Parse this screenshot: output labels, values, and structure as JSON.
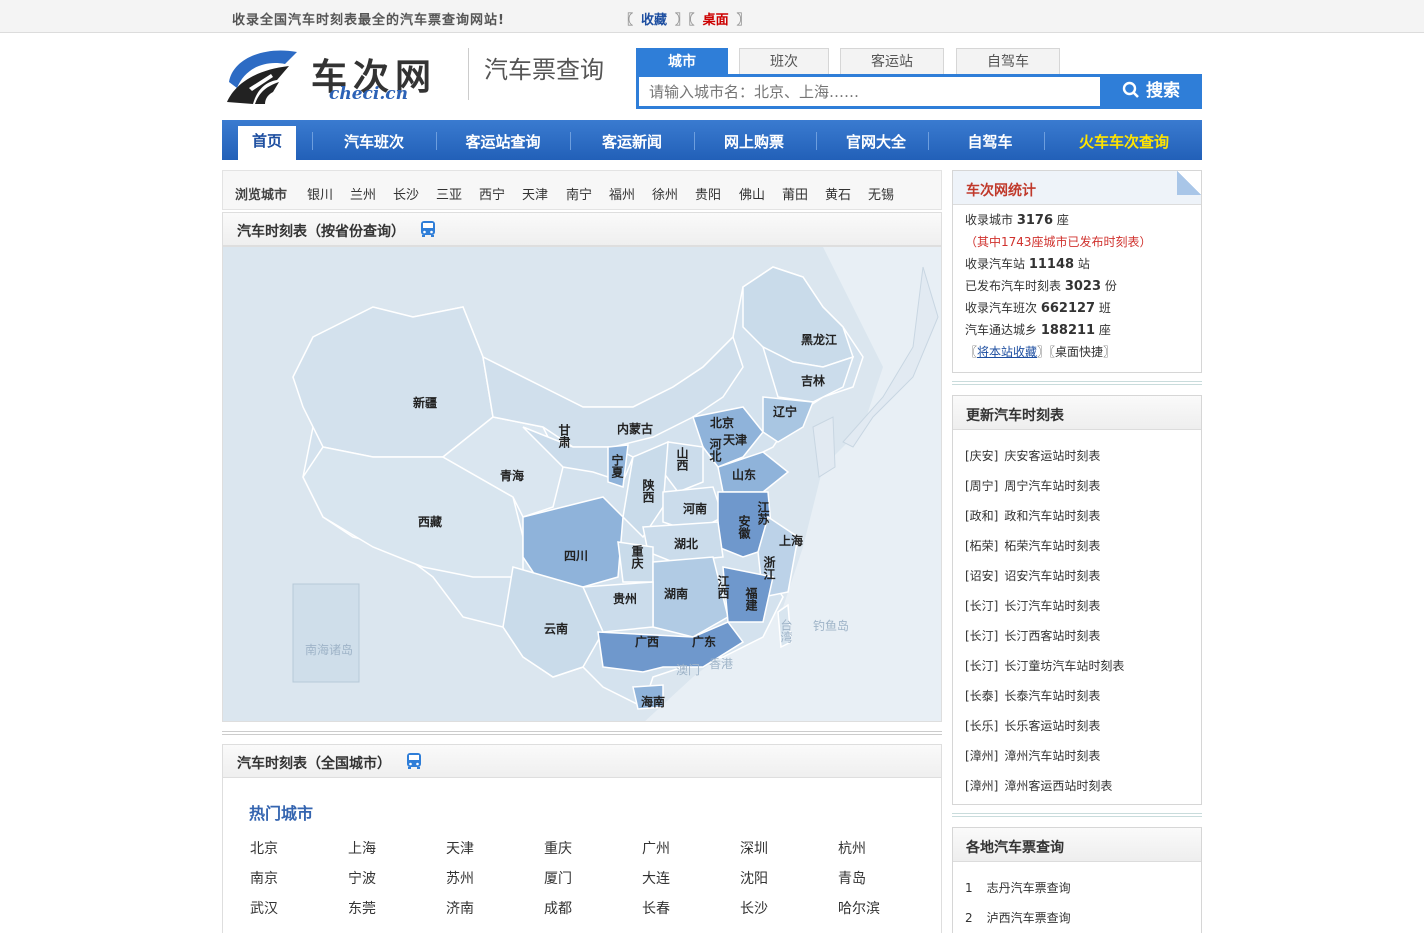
{
  "topbar": {
    "slogan": "收录全国汽车时刻表最全的汽车票查询网站!",
    "bracket_l": "〖",
    "bracket_r": "〗",
    "fav": "收藏",
    "desktop": "桌面"
  },
  "logo": {
    "cn": "车次网",
    "en": "checi.cn"
  },
  "header_title": "汽车票查询",
  "search": {
    "tabs": [
      "城市",
      "班次",
      "客运站",
      "自驾车"
    ],
    "placeholder": "请输入城市名：北京、上海……",
    "button": "搜索"
  },
  "nav": [
    "首页",
    "汽车班次",
    "客运站查询",
    "客运新闻",
    "网上购票",
    "官网大全",
    "自驾车",
    "火车车次查询"
  ],
  "browse": {
    "label": "浏览城市",
    "cities": [
      "银川",
      "兰州",
      "长沙",
      "三亚",
      "西宁",
      "天津",
      "南宁",
      "福州",
      "徐州",
      "贵阳",
      "佛山",
      "莆田",
      "黄石",
      "无锡"
    ]
  },
  "map_panel": {
    "title": "汽车时刻表（按省份查询）",
    "provinces": [
      "黑龙江",
      "吉林",
      "辽宁",
      "北京",
      "天津",
      "河北",
      "山东",
      "内蒙古",
      "新疆",
      "甘肃",
      "宁夏",
      "山西",
      "陕西",
      "青海",
      "西藏",
      "河南",
      "江苏",
      "安徽",
      "上海",
      "四川",
      "湖北",
      "重庆",
      "浙江",
      "江西",
      "湖南",
      "贵州",
      "福建",
      "云南",
      "广西",
      "广东",
      "台湾",
      "钓鱼岛",
      "澳门",
      "香港",
      "海南",
      "南海诸岛"
    ]
  },
  "hot_panel": {
    "title": "汽车时刻表（全国城市）",
    "subtitle": "热门城市",
    "cities": [
      "北京",
      "上海",
      "天津",
      "重庆",
      "广州",
      "深圳",
      "杭州",
      "南京",
      "宁波",
      "苏州",
      "厦门",
      "大连",
      "沈阳",
      "青岛",
      "武汉",
      "东莞",
      "济南",
      "成都",
      "长春",
      "长沙",
      "哈尔滨"
    ]
  },
  "stats": {
    "title": "车次网统计",
    "rows": [
      {
        "pre": "收录城市 ",
        "num": "3176",
        "post": " 座"
      },
      {
        "pre": "（其中1743座城市已发布时刻表）",
        "num": "",
        "post": ""
      },
      {
        "pre": "收录汽车站 ",
        "num": "11148",
        "post": " 站"
      },
      {
        "pre": "已发布汽车时刻表 ",
        "num": "3023",
        "post": " 份"
      },
      {
        "pre": "收录汽车班次 ",
        "num": "662127",
        "post": " 班"
      },
      {
        "pre": "汽车通达城乡 ",
        "num": "188211",
        "post": " 座"
      }
    ],
    "links": [
      "将本站收藏",
      "桌面快捷"
    ]
  },
  "updates": {
    "title": "更新汽车时刻表",
    "items": [
      {
        "tag": "[庆安]",
        "name": "庆安客运站时刻表"
      },
      {
        "tag": "[周宁]",
        "name": "周宁汽车站时刻表"
      },
      {
        "tag": "[政和]",
        "name": "政和汽车站时刻表"
      },
      {
        "tag": "[柘荣]",
        "name": "柘荣汽车站时刻表"
      },
      {
        "tag": "[诏安]",
        "name": "诏安汽车站时刻表"
      },
      {
        "tag": "[长汀]",
        "name": "长汀汽车站时刻表"
      },
      {
        "tag": "[长汀]",
        "name": "长汀西客站时刻表"
      },
      {
        "tag": "[长汀]",
        "name": "长汀童坊汽车站时刻表"
      },
      {
        "tag": "[长泰]",
        "name": "长泰汽车站时刻表"
      },
      {
        "tag": "[长乐]",
        "name": "长乐客运站时刻表"
      },
      {
        "tag": "[漳州]",
        "name": "漳州汽车站时刻表"
      },
      {
        "tag": "[漳州]",
        "name": "漳州客运西站时刻表"
      }
    ]
  },
  "regional": {
    "title": "各地汽车票查询",
    "items": [
      {
        "num": "1",
        "name": "志丹汽车票查询"
      },
      {
        "num": "2",
        "name": "泸西汽车票查询"
      }
    ]
  },
  "colors": {
    "brand_blue": "#2f7ed8",
    "nav_blue": "#2260b8",
    "highlight_yellow": "#ffe400",
    "stat_red": "#d0312d"
  }
}
